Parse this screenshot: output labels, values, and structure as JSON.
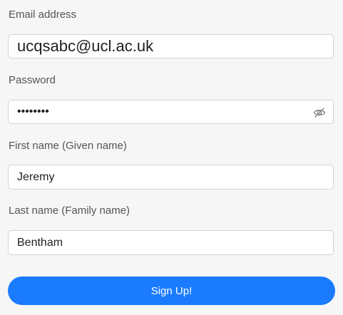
{
  "form": {
    "email": {
      "label": "Email address",
      "value": "ucqsabc@ucl.ac.uk"
    },
    "password": {
      "label": "Password",
      "value": "••••••••",
      "toggle_icon": "eye-slash-icon"
    },
    "first_name": {
      "label": "First name (Given name)",
      "value": "Jeremy"
    },
    "last_name": {
      "label": "Last name (Family name)",
      "value": "Bentham"
    },
    "submit_label": "Sign Up!"
  },
  "colors": {
    "background": "#f6f6f6",
    "field_border": "#d4d4d4",
    "primary": "#1a7bff",
    "label_text": "#555555"
  }
}
